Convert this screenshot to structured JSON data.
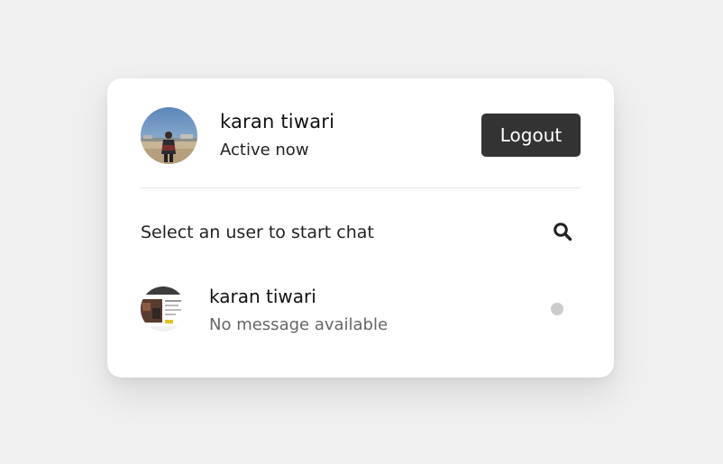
{
  "header": {
    "user_name": "karan tiwari",
    "status": "Active now",
    "logout_label": "Logout"
  },
  "search": {
    "label": "Select an user to start chat",
    "icon": "search-icon"
  },
  "users": [
    {
      "name": "karan tiwari",
      "last_message": "No message available",
      "status": "offline"
    }
  ],
  "colors": {
    "background": "#f0f0f0",
    "card": "#ffffff",
    "logout_button": "#333333",
    "offline_dot": "#cccccc",
    "muted_text": "#666666"
  }
}
